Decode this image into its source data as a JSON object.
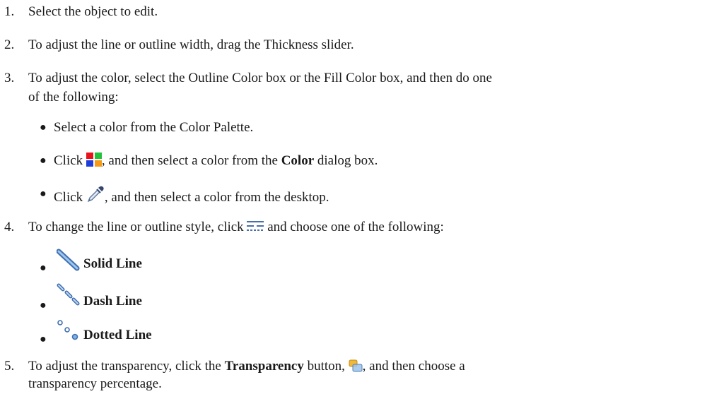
{
  "steps": [
    {
      "num": "1.",
      "text": "Select the object to edit."
    },
    {
      "num": "2.",
      "text": "To adjust the line or outline width, drag the Thickness slider."
    },
    {
      "num": "3.",
      "text_line1": "To adjust the color, select the Outline Color box or the Fill Color box, and then do one",
      "text_line2": "of the following:"
    },
    {
      "num": "4.",
      "text_a": "To change the line or outline style, click",
      "text_b": "and choose one of the following:"
    },
    {
      "num": "5.",
      "text_a": "To adjust the transparency, click the",
      "bold": "Transparency",
      "text_b": "button,",
      "text_c": ", and then choose a",
      "text_line2": "transparency percentage."
    }
  ],
  "color_options": {
    "opt1": "Select a color from the Color Palette.",
    "opt2_a": "Click",
    "opt2_b": ", and then select a color from the",
    "opt2_bold": "Color",
    "opt2_c": "dialog box.",
    "opt3_a": "Click",
    "opt3_b": ", and then select a color from the desktop."
  },
  "line_styles": [
    "Solid Line",
    "Dash Line",
    "Dotted Line"
  ],
  "bullet": "●",
  "icons": {
    "color_picker": "color-grid-icon",
    "eyedropper": "eyedropper-icon",
    "line_style": "line-style-icon",
    "solid": "solid-line-icon",
    "dash": "dash-line-icon",
    "dotted": "dotted-line-icon",
    "transparency": "transparency-icon"
  }
}
